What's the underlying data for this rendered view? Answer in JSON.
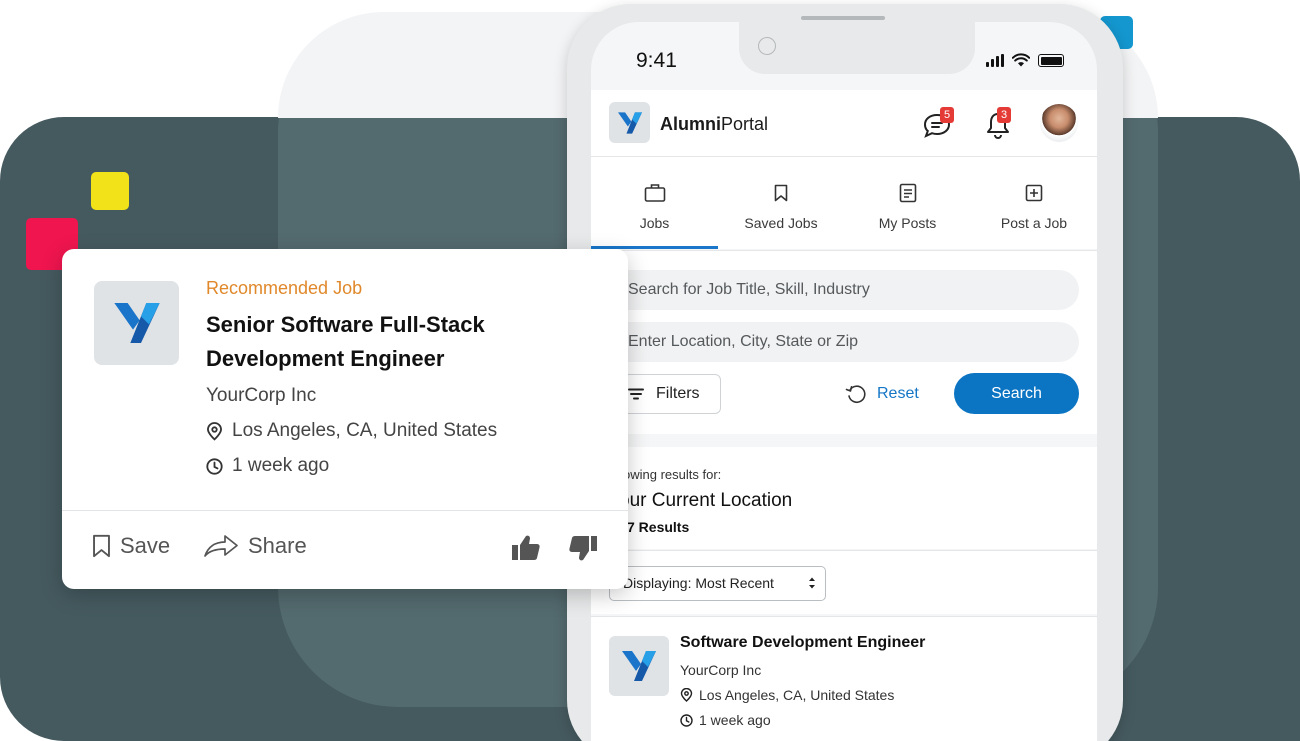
{
  "phone": {
    "status_time": "9:41"
  },
  "app": {
    "brand_bold": "Alumni",
    "brand_rest": "Portal",
    "messages_count": "5",
    "notifications_count": "3"
  },
  "tabs": [
    {
      "label": "Jobs",
      "icon": "briefcase-icon",
      "active": true
    },
    {
      "label": "Saved Jobs",
      "icon": "bookmark-icon",
      "active": false
    },
    {
      "label": "My Posts",
      "icon": "document-icon",
      "active": false
    },
    {
      "label": "Post a Job",
      "icon": "plus-square-icon",
      "active": false
    }
  ],
  "search": {
    "keyword_placeholder": "Search for Job Title,  Skill, Industry",
    "location_placeholder": "Enter Location, City, State or Zip",
    "filters_label": "Filters",
    "reset_label": "Reset",
    "search_label": "Search"
  },
  "results": {
    "showing_label": "owing results for:",
    "location_title": "our Current Location",
    "count_label": "7 Results",
    "sort_label": "Displaying: Most Recent"
  },
  "job_listing": {
    "title": "Software Development Engineer",
    "company": "YourCorp Inc",
    "location": "Los Angeles, CA, United States",
    "posted": "1 week ago"
  },
  "recommended": {
    "kicker": "Recommended Job",
    "title": "Senior Software Full-Stack Development Engineer",
    "company": "YourCorp Inc",
    "location": "Los Angeles, CA, United States",
    "posted": "1 week ago",
    "save_label": "Save",
    "share_label": "Share"
  },
  "colors": {
    "accent": "#0b74c3",
    "kicker": "#e0882a",
    "badge": "#e43b37",
    "background_panel": "#455a5f"
  }
}
